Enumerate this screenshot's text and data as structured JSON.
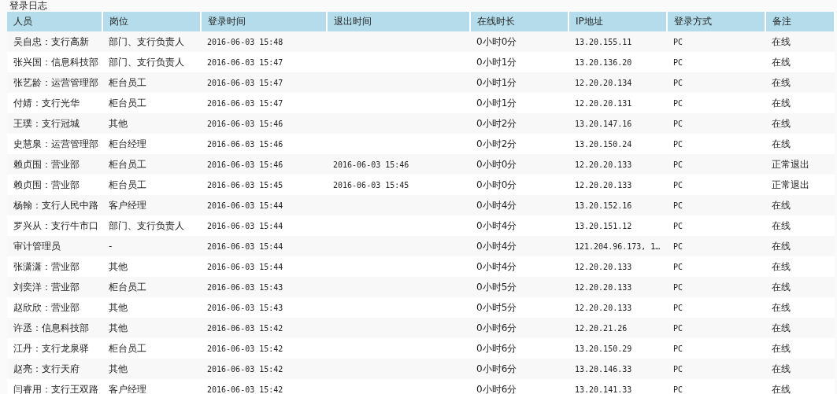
{
  "title": "登录日志",
  "table": {
    "columns": [
      "人员",
      "岗位",
      "登录时间",
      "退出时间",
      "在线时长",
      "IP地址",
      "登录方式",
      "备注"
    ],
    "rows": [
      [
        "吴自忠：支行高新",
        "部门、支行负责人",
        "2016-06-03 15:48",
        "",
        "0小时0分",
        "13.20.155.11",
        "PC",
        "在线"
      ],
      [
        "张兴国：信息科技部",
        "部门、支行负责人",
        "2016-06-03 15:47",
        "",
        "0小时1分",
        "13.20.136.20",
        "PC",
        "在线"
      ],
      [
        "张艺龄：运营管理部",
        "柜台员工",
        "2016-06-03 15:47",
        "",
        "0小时1分",
        "12.20.20.134",
        "PC",
        "在线"
      ],
      [
        "付婧：支行光华",
        "柜台员工",
        "2016-06-03 15:47",
        "",
        "0小时1分",
        "12.20.20.131",
        "PC",
        "在线"
      ],
      [
        "王璞：支行冠城",
        "其他",
        "2016-06-03 15:46",
        "",
        "0小时2分",
        "13.20.147.16",
        "PC",
        "在线"
      ],
      [
        "史慧泉：运营管理部",
        "柜台经理",
        "2016-06-03 15:46",
        "",
        "0小时2分",
        "13.20.150.24",
        "PC",
        "在线"
      ],
      [
        "赖贞围：营业部",
        "柜台员工",
        "2016-06-03 15:46",
        "2016-06-03 15:46",
        "0小时0分",
        "12.20.20.133",
        "PC",
        "正常退出"
      ],
      [
        "赖贞围：营业部",
        "柜台员工",
        "2016-06-03 15:45",
        "2016-06-03 15:45",
        "0小时0分",
        "12.20.20.133",
        "PC",
        "正常退出"
      ],
      [
        "杨翰：支行人民中路",
        "客户经理",
        "2016-06-03 15:44",
        "",
        "0小时4分",
        "13.20.152.16",
        "PC",
        "在线"
      ],
      [
        "罗兴从：支行牛市口",
        "部门、支行负责人",
        "2016-06-03 15:44",
        "",
        "0小时4分",
        "13.20.151.12",
        "PC",
        "在线"
      ],
      [
        "审计管理员",
        "-",
        "2016-06-03 15:44",
        "",
        "0小时4分",
        "121.204.96.173, 1…",
        "PC",
        "在线"
      ],
      [
        "张潇潇：营业部",
        "其他",
        "2016-06-03 15:44",
        "",
        "0小时4分",
        "12.20.20.133",
        "PC",
        "在线"
      ],
      [
        "刘奕洋：营业部",
        "柜台员工",
        "2016-06-03 15:43",
        "",
        "0小时5分",
        "12.20.20.133",
        "PC",
        "在线"
      ],
      [
        "赵欣欣：营业部",
        "其他",
        "2016-06-03 15:43",
        "",
        "0小时5分",
        "12.20.20.133",
        "PC",
        "在线"
      ],
      [
        "许丞：信息科技部",
        "其他",
        "2016-06-03 15:42",
        "",
        "0小时6分",
        "12.20.21.26",
        "PC",
        "在线"
      ],
      [
        "江丹：支行龙泉驿",
        "柜台员工",
        "2016-06-03 15:42",
        "",
        "0小时6分",
        "13.20.150.29",
        "PC",
        "在线"
      ],
      [
        "赵亮：支行天府",
        "其他",
        "2016-06-03 15:42",
        "",
        "0小时6分",
        "13.20.146.33",
        "PC",
        "在线"
      ],
      [
        "闫睿用：支行王双路",
        "客户经理",
        "2016-06-03 15:42",
        "",
        "0小时6分",
        "13.20.141.33",
        "PC",
        "在线"
      ]
    ]
  }
}
